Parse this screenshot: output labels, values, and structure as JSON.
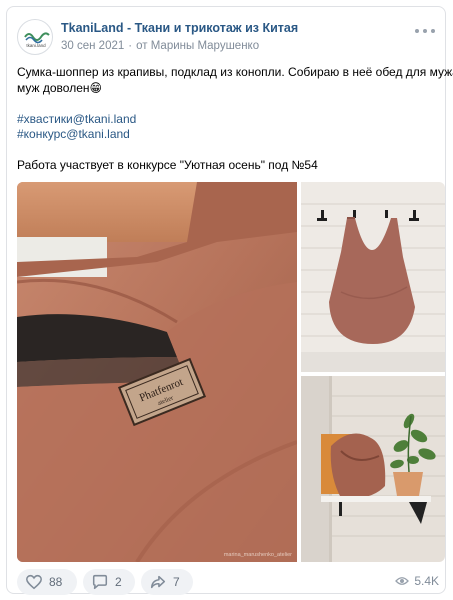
{
  "post": {
    "author": "TkaniLand - Ткани и трикотаж из Китая",
    "date": "30 сен 2021",
    "attribution": "от Марины Марушенко",
    "avatar_text": "tkani.land",
    "text_lines": [
      "Сумка-шоппер из крапивы, подклад из конопли. Собираю в неё обед для мужа,",
      "муж доволен😁"
    ],
    "hashtags": [
      "#хвастики@tkani.land",
      "#конкурс@tkani.land"
    ],
    "contest_line": "Работа участвует в конкурсе \"Уютная осень\" под №54"
  },
  "photos": {
    "label_brand": "Phatfenrot",
    "label_sub": "atelier",
    "watermark": "marina_marushenko_atelier"
  },
  "actions": {
    "likes": "88",
    "comments": "2",
    "shares": "7",
    "views": "5.4K"
  },
  "colors": {
    "link": "#2a5885",
    "muted": "#818c99",
    "fabric": "#b3725c",
    "action_bg": "#f0f2f5"
  }
}
